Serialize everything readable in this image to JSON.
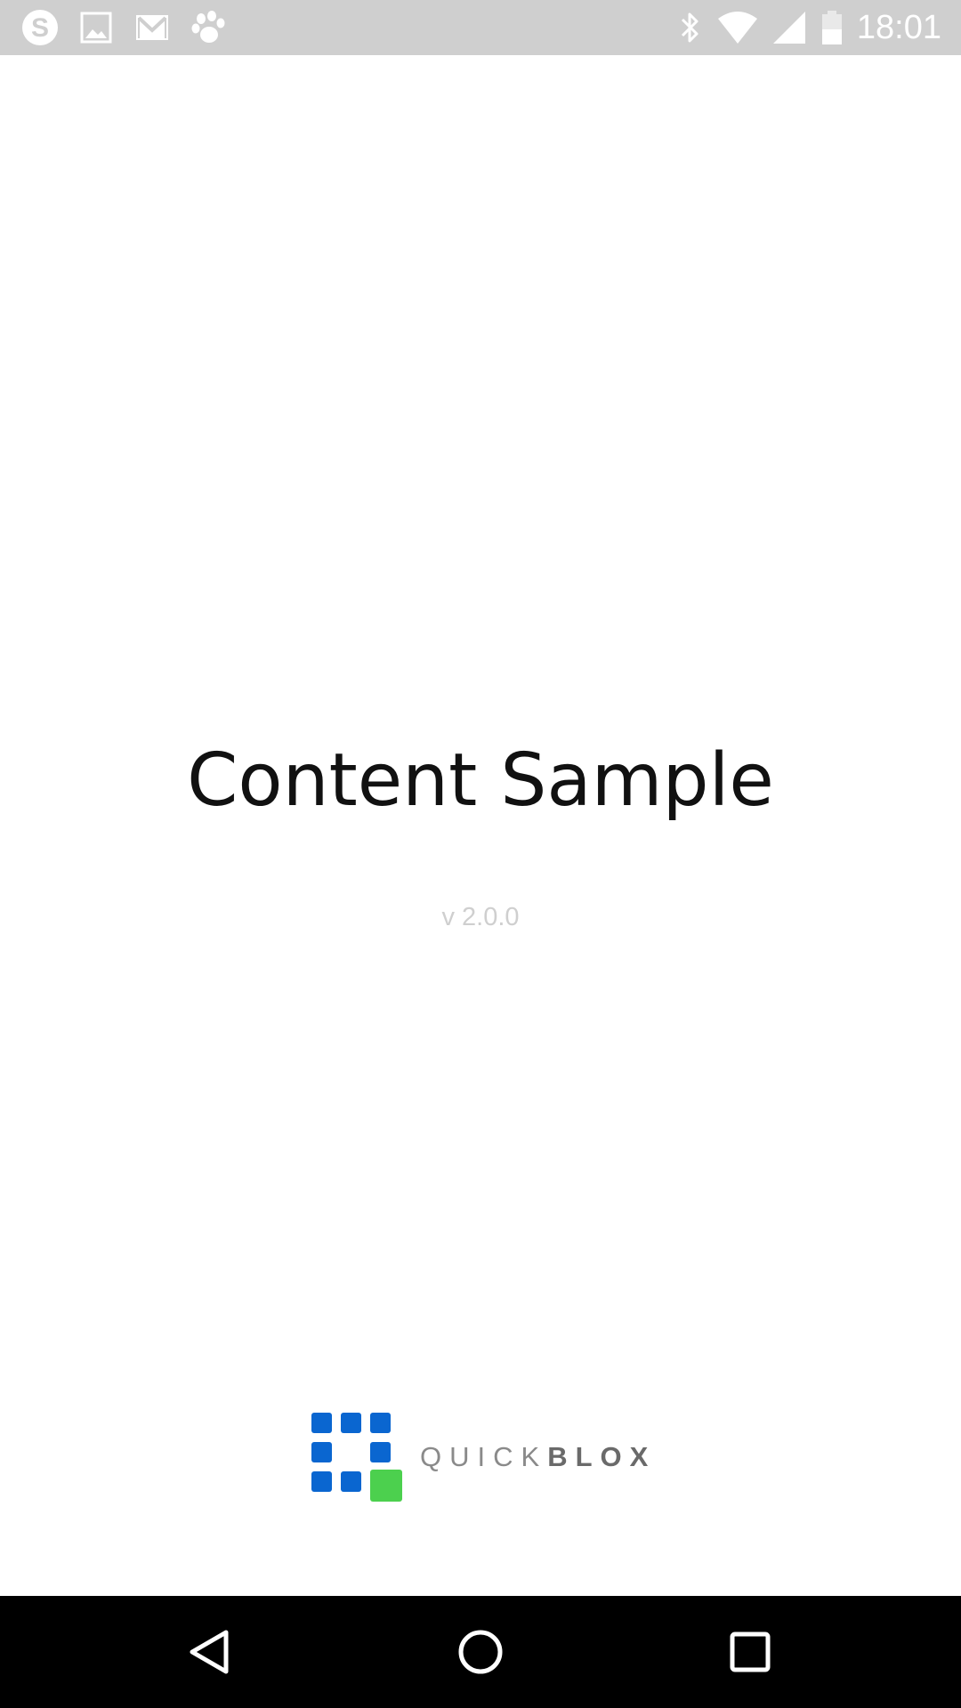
{
  "status_bar": {
    "time": "18:01",
    "left_icons": [
      "skype-icon",
      "gallery-icon",
      "gmail-icon",
      "paw-icon"
    ],
    "right_icons": [
      "bluetooth-icon",
      "wifi-icon",
      "cell-signal-icon",
      "battery-icon"
    ],
    "background": "#cfcfcf"
  },
  "main": {
    "title": "Content Sample",
    "version": "v 2.0.0"
  },
  "brand": {
    "name_light": "QUICK",
    "name_bold": "BLOX",
    "blue": "#0a66d0",
    "green": "#4cd04e"
  },
  "nav_bar": {
    "buttons": [
      "back-icon",
      "home-icon",
      "recents-icon"
    ]
  }
}
